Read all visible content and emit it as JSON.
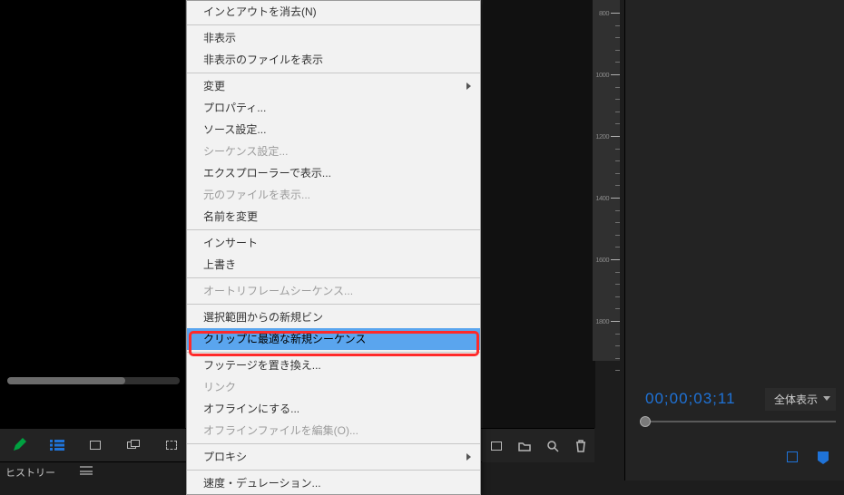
{
  "history_label": "ヒストリー",
  "timecode": "00;00;03;11",
  "fit_label": "全体表示",
  "ruler_ticks": [
    "800",
    "1000",
    "1200",
    "1400",
    "1600",
    "1800"
  ],
  "ctx": [
    {
      "label": "インとアウトを消去(N)",
      "sep_after": true
    },
    {
      "label": "非表示"
    },
    {
      "label": "非表示のファイルを表示",
      "sep_after": true
    },
    {
      "label": "変更",
      "submenu": true
    },
    {
      "label": "プロパティ..."
    },
    {
      "label": "ソース設定..."
    },
    {
      "label": "シーケンス設定...",
      "disabled": true
    },
    {
      "label": "エクスプローラーで表示..."
    },
    {
      "label": "元のファイルを表示...",
      "disabled": true
    },
    {
      "label": "名前を変更",
      "sep_after": true
    },
    {
      "label": "インサート"
    },
    {
      "label": "上書き",
      "sep_after": true
    },
    {
      "label": "オートリフレームシーケンス...",
      "disabled": true,
      "sep_after": true
    },
    {
      "label": "選択範囲からの新規ビン"
    },
    {
      "label": "クリップに最適な新規シーケンス",
      "selected": true,
      "sep_after": true
    },
    {
      "label": "フッテージを置き換え..."
    },
    {
      "label": "リンク",
      "disabled": true
    },
    {
      "label": "オフラインにする..."
    },
    {
      "label": "オフラインファイルを編集(O)...",
      "disabled": true,
      "sep_after": true
    },
    {
      "label": "プロキシ",
      "submenu": true,
      "sep_after": true
    },
    {
      "label": "速度・デュレーション..."
    }
  ],
  "toolbar_left_icons": [
    "pencil-icon",
    "list-icon",
    "frame-icon",
    "stack-icon",
    "clip-icon"
  ],
  "toolbar_mid_icons": [
    "new-item-icon",
    "folder-icon",
    "search-icon",
    "trash-icon"
  ],
  "right_mini_icons": [
    "marker-icon",
    "tag-icon"
  ]
}
